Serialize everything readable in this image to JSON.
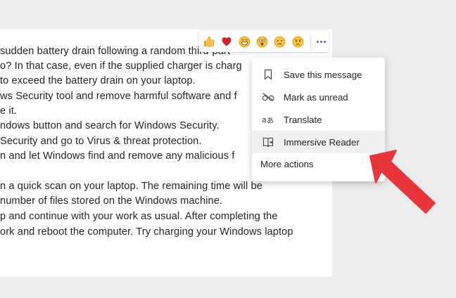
{
  "message": {
    "lines": [
      "sudden battery drain following a random third-part",
      "o? In that case, even if the supplied charger is charg",
      "to exceed the battery drain on your laptop.",
      "ws Security tool and remove harmful software and f",
      "e it.",
      "ndows button and search for Windows Security.",
      "Security and go to Virus & threat protection.",
      "n and let Windows find and remove any malicious f",
      "",
      "n a quick scan on your laptop. The remaining time will be",
      "number of files stored on the Windows machine.",
      "p and continue with your work as usual. After completing the",
      "ork and reboot the computer. Try charging your Windows laptop"
    ]
  },
  "reactions": [
    {
      "name": "like-reaction-icon"
    },
    {
      "name": "heart-reaction-icon"
    },
    {
      "name": "laugh-reaction-icon"
    },
    {
      "name": "surprised-reaction-icon"
    },
    {
      "name": "sad-reaction-icon"
    },
    {
      "name": "angry-reaction-icon"
    }
  ],
  "menu": {
    "items": [
      {
        "label": "Save this message",
        "icon": "bookmark-icon"
      },
      {
        "label": "Mark as unread",
        "icon": "unread-glasses-icon"
      },
      {
        "label": "Translate",
        "icon": "translate-icon"
      },
      {
        "label": "Immersive Reader",
        "icon": "immersive-reader-icon",
        "highlighted": true
      }
    ],
    "more_actions": "More actions"
  },
  "colors": {
    "accent": "#5b5fc7",
    "annotation_arrow": "#e8343b",
    "heart": "#d1252e",
    "emoji_yellow": "#f6c243"
  }
}
